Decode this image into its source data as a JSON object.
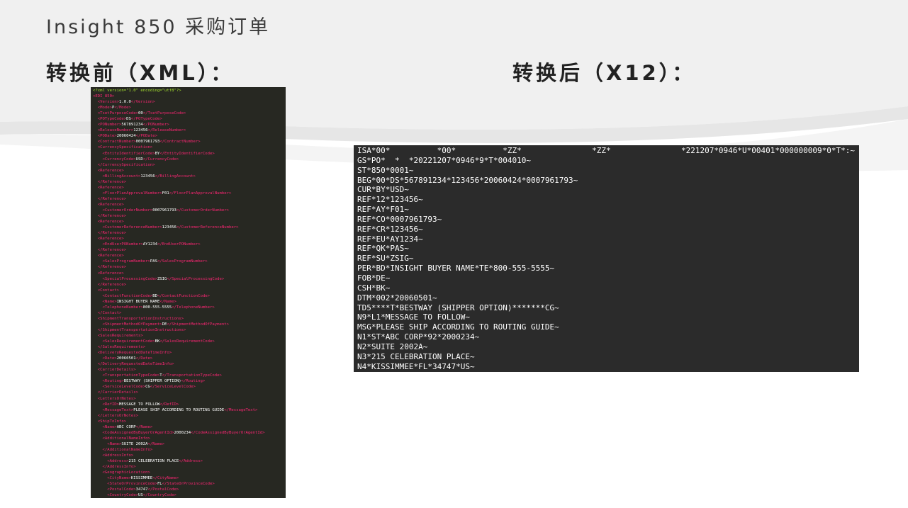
{
  "title": "Insight 850 采购订单",
  "before_heading": "转换前（XML）：",
  "after_heading": "转换后（X12）：",
  "xml_lines": [
    [
      [
        "decl",
        "<?xml version=\"1.0\" encoding=\"utf8\"?>"
      ]
    ],
    [
      [
        "tag",
        "<EDI_850>"
      ]
    ],
    [
      [
        "tag",
        "  <Version>"
      ],
      [
        "txt",
        "1.0.0"
      ],
      [
        "tag",
        "</Version>"
      ]
    ],
    [
      [
        "tag",
        "  <Mode>"
      ],
      [
        "txt",
        "P"
      ],
      [
        "tag",
        "</Mode>"
      ]
    ],
    [
      [
        "tag",
        "  <TsetPurposeCode>"
      ],
      [
        "txt",
        "00"
      ],
      [
        "tag",
        "</TsetPurposeCode>"
      ]
    ],
    [
      [
        "tag",
        "  <POTypeCode>"
      ],
      [
        "txt",
        "DS"
      ],
      [
        "tag",
        "</POTypeCode>"
      ]
    ],
    [
      [
        "tag",
        "  <PONumber>"
      ],
      [
        "txt",
        "567891234"
      ],
      [
        "tag",
        "</PONumber>"
      ]
    ],
    [
      [
        "tag",
        "  <ReleaseNumber>"
      ],
      [
        "txt",
        "123456"
      ],
      [
        "tag",
        "</ReleaseNumber>"
      ]
    ],
    [
      [
        "tag",
        "  <PODate>"
      ],
      [
        "txt",
        "20060424"
      ],
      [
        "tag",
        "</PODate>"
      ]
    ],
    [
      [
        "tag",
        "  <ContractNumber>"
      ],
      [
        "txt",
        "0007961793"
      ],
      [
        "tag",
        "</ContractNumber>"
      ]
    ],
    [
      [
        "tag",
        "  <CurrencySpecification>"
      ]
    ],
    [
      [
        "tag",
        "    <EntityIdentifierCode>"
      ],
      [
        "txt",
        "BY"
      ],
      [
        "tag",
        "</EntityIdentifierCode>"
      ]
    ],
    [
      [
        "tag",
        "    <CurrencyCode>"
      ],
      [
        "txt",
        "USD"
      ],
      [
        "tag",
        "</CurrencyCode>"
      ]
    ],
    [
      [
        "tag",
        "  </CurrencySpecification>"
      ]
    ],
    [
      [
        "tag",
        "  <Reference>"
      ]
    ],
    [
      [
        "tag",
        "    <BillingAccount>"
      ],
      [
        "txt",
        "123456"
      ],
      [
        "tag",
        "</BillingAccount>"
      ]
    ],
    [
      [
        "tag",
        "  </Reference>"
      ]
    ],
    [
      [
        "tag",
        "  <Reference>"
      ]
    ],
    [
      [
        "tag",
        "    <FloorPlanApprovalNumber>"
      ],
      [
        "txt",
        "F01"
      ],
      [
        "tag",
        "</FloorPlanApprovalNumber>"
      ]
    ],
    [
      [
        "tag",
        "  </Reference>"
      ]
    ],
    [
      [
        "tag",
        "  <Reference>"
      ]
    ],
    [
      [
        "tag",
        "    <CustomerOrderNumber>"
      ],
      [
        "txt",
        "0007961793"
      ],
      [
        "tag",
        "</CustomerOrderNumber>"
      ]
    ],
    [
      [
        "tag",
        "  </Reference>"
      ]
    ],
    [
      [
        "tag",
        "  <Reference>"
      ]
    ],
    [
      [
        "tag",
        "    <CustomerReferenceNumber>"
      ],
      [
        "txt",
        "123456"
      ],
      [
        "tag",
        "</CustomerReferenceNumber>"
      ]
    ],
    [
      [
        "tag",
        "  </Reference>"
      ]
    ],
    [
      [
        "tag",
        "  <Reference>"
      ]
    ],
    [
      [
        "tag",
        "    <EndUserPONumber>"
      ],
      [
        "txt",
        "AY1234"
      ],
      [
        "tag",
        "</EndUserPONumber>"
      ]
    ],
    [
      [
        "tag",
        "  </Reference>"
      ]
    ],
    [
      [
        "tag",
        "  <Reference>"
      ]
    ],
    [
      [
        "tag",
        "    <SalesProgramNumber>"
      ],
      [
        "txt",
        "PAS"
      ],
      [
        "tag",
        "</SalesProgramNumber>"
      ]
    ],
    [
      [
        "tag",
        "  </Reference>"
      ]
    ],
    [
      [
        "tag",
        "  <Reference>"
      ]
    ],
    [
      [
        "tag",
        "    <SpecialProcessingCode>"
      ],
      [
        "txt",
        "ZSIG"
      ],
      [
        "tag",
        "</SpecialProcessingCode>"
      ]
    ],
    [
      [
        "tag",
        "  </Reference>"
      ]
    ],
    [
      [
        "tag",
        "  <Contact>"
      ]
    ],
    [
      [
        "tag",
        "    <ContactFunctionCode>"
      ],
      [
        "txt",
        "BD"
      ],
      [
        "tag",
        "</ContactFunctionCode>"
      ]
    ],
    [
      [
        "tag",
        "    <Name>"
      ],
      [
        "txt",
        "INSIGHT BUYER NAME"
      ],
      [
        "tag",
        "</Name>"
      ]
    ],
    [
      [
        "tag",
        "    <TelephoneNumber>"
      ],
      [
        "txt",
        "800-555-5555"
      ],
      [
        "tag",
        "</TelephoneNumber>"
      ]
    ],
    [
      [
        "tag",
        "  </Contact>"
      ]
    ],
    [
      [
        "tag",
        "  <ShipmentTransportationInstructions>"
      ]
    ],
    [
      [
        "tag",
        "    <ShipmentMethodOfPayment>"
      ],
      [
        "txt",
        "DE"
      ],
      [
        "tag",
        "</ShipmentMethodOfPayment>"
      ]
    ],
    [
      [
        "tag",
        "  </ShipmentTransportationInstructions>"
      ]
    ],
    [
      [
        "tag",
        "  <SalesRequirements>"
      ]
    ],
    [
      [
        "tag",
        "    <SalesRequirementCode>"
      ],
      [
        "txt",
        "BK"
      ],
      [
        "tag",
        "</SalesRequirementCode>"
      ]
    ],
    [
      [
        "tag",
        "  </SalesRequirements>"
      ]
    ],
    [
      [
        "tag",
        "  <DeliveryRequestedDateTimeInfo>"
      ]
    ],
    [
      [
        "tag",
        "    <Date>"
      ],
      [
        "txt",
        "20060501"
      ],
      [
        "tag",
        "</Date>"
      ]
    ],
    [
      [
        "tag",
        "  </DeliveryRequestedDateTimeInfo>"
      ]
    ],
    [
      [
        "tag",
        "  <CarrierDetails>"
      ]
    ],
    [
      [
        "tag",
        "    <TransportationTypeCode>"
      ],
      [
        "txt",
        "T"
      ],
      [
        "tag",
        "</TransportationTypeCode>"
      ]
    ],
    [
      [
        "tag",
        "    <Routing>"
      ],
      [
        "txt",
        "BESTWAY (SHIPPER OPTION)"
      ],
      [
        "tag",
        "</Routing>"
      ]
    ],
    [
      [
        "tag",
        "    <ServiceLevelCode>"
      ],
      [
        "txt",
        "CG"
      ],
      [
        "tag",
        "</ServiceLevelCode>"
      ]
    ],
    [
      [
        "tag",
        "  </CarrierDetails>"
      ]
    ],
    [
      [
        "tag",
        "  <LettersOrNotes>"
      ]
    ],
    [
      [
        "tag",
        "    <RefID>"
      ],
      [
        "txt",
        "MESSAGE TO FOLLOW"
      ],
      [
        "tag",
        "</RefID>"
      ]
    ],
    [
      [
        "tag",
        "    <MessageText>"
      ],
      [
        "txt",
        "PLEASE SHIP ACCORDING TO ROUTING GUIDE"
      ],
      [
        "tag",
        "</MessageText>"
      ]
    ],
    [
      [
        "tag",
        "  </LettersOrNotes>"
      ]
    ],
    [
      [
        "tag",
        "  <ShipToInfo>"
      ]
    ],
    [
      [
        "tag",
        "    <Name>"
      ],
      [
        "txt",
        "ABC CORP"
      ],
      [
        "tag",
        "</Name>"
      ]
    ],
    [
      [
        "tag",
        "    <CodeAssignedByBuyerOrAgentId>"
      ],
      [
        "txt",
        "2000234"
      ],
      [
        "tag",
        "</CodeAssignedByBuyerOrAgentId>"
      ]
    ],
    [
      [
        "tag",
        "    <AdditionalNameInfo>"
      ]
    ],
    [
      [
        "tag",
        "      <Name>"
      ],
      [
        "txt",
        "SUITE 2002A"
      ],
      [
        "tag",
        "</Name>"
      ]
    ],
    [
      [
        "tag",
        "    </AdditionalNameInfo>"
      ]
    ],
    [
      [
        "tag",
        "    <AddressInfo>"
      ]
    ],
    [
      [
        "tag",
        "      <Address>"
      ],
      [
        "txt",
        "215 CELEBRATION PLACE"
      ],
      [
        "tag",
        "</Address>"
      ]
    ],
    [
      [
        "tag",
        "    </AddressInfo>"
      ]
    ],
    [
      [
        "tag",
        "    <GeographicLocation>"
      ]
    ],
    [
      [
        "tag",
        "      <CityName>"
      ],
      [
        "txt",
        "KISSIMMEE"
      ],
      [
        "tag",
        "</CityName>"
      ]
    ],
    [
      [
        "tag",
        "      <StateOrProvinceCode>"
      ],
      [
        "txt",
        "FL"
      ],
      [
        "tag",
        "</StateOrProvinceCode>"
      ]
    ],
    [
      [
        "tag",
        "      <PostalCode>"
      ],
      [
        "txt",
        "34747"
      ],
      [
        "tag",
        "</PostalCode>"
      ]
    ],
    [
      [
        "tag",
        "      <CountryCode>"
      ],
      [
        "txt",
        "US"
      ],
      [
        "tag",
        "</CountryCode>"
      ]
    ]
  ],
  "x12_lines": [
    "ISA*00*          *00*          *ZZ*               *ZZ*               *221207*0946*U*00401*000000009*0*T*:~",
    "GS*PO*  *  *20221207*0946*9*T*004010~",
    "ST*850*0001~",
    "BEG*00*DS*567891234*123456*20060424*0007961793~",
    "CUR*BY*USD~",
    "REF*12*123456~",
    "REF*AY*F01~",
    "REF*CO*0007961793~",
    "REF*CR*123456~",
    "REF*EU*AY1234~",
    "REF*QK*PAS~",
    "REF*SU*ZSIG~",
    "PER*BD*INSIGHT BUYER NAME*TE*800-555-5555~",
    "FOB*DE~",
    "CSH*BK~",
    "DTM*002*20060501~",
    "TD5****T*BESTWAY (SHIPPER OPTION)*******CG~",
    "N9*L1*MESSAGE TO FOLLOW~",
    "MSG*PLEASE SHIP ACCORDING TO ROUTING GUIDE~",
    "N1*ST*ABC CORP*92*2000234~",
    "N2*SUITE 2002A~",
    "N3*215 CELEBRATION PLACE~",
    "N4*KISSIMMEE*FL*34747*US~"
  ]
}
